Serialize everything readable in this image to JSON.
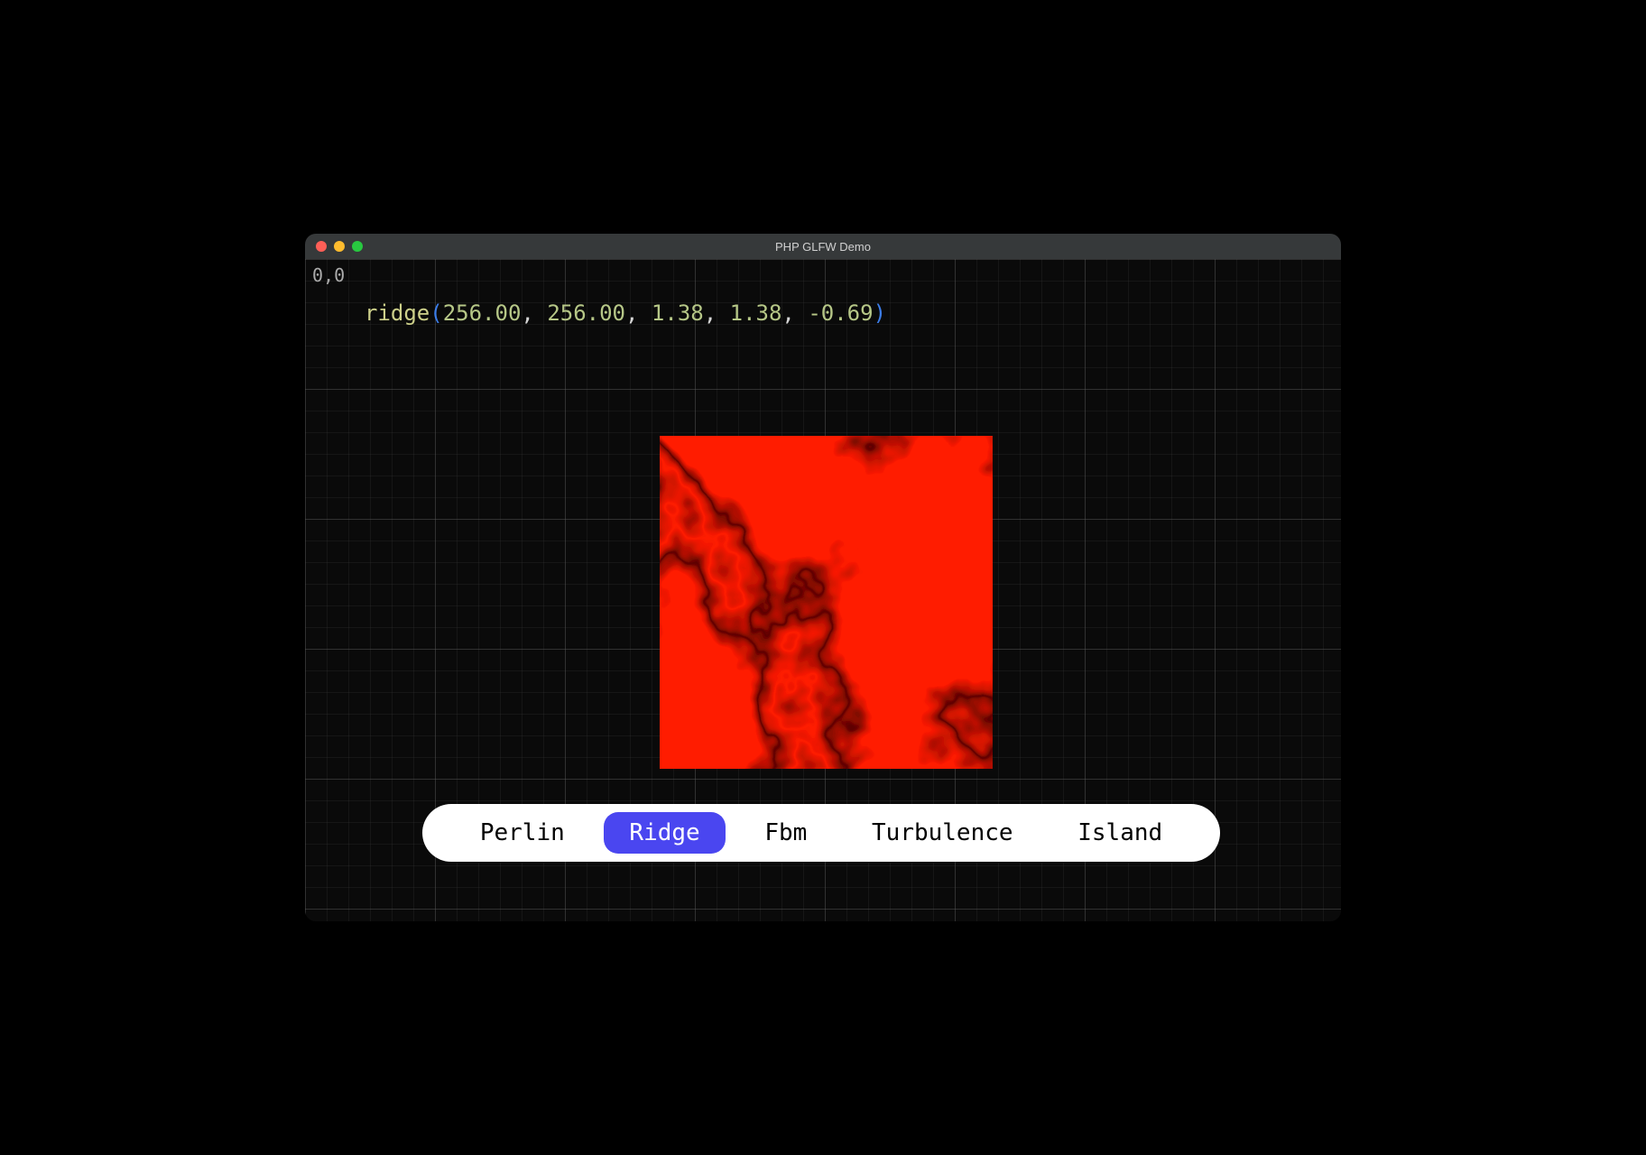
{
  "window": {
    "title": "PHP GLFW Demo"
  },
  "viewport": {
    "origin_label": "0,0"
  },
  "function_call": {
    "name": "ridge",
    "arg1": "256.00",
    "arg2": "256.00",
    "arg3": "1.38",
    "arg4": "1.38",
    "arg5": "-0.69"
  },
  "tabs": {
    "items": [
      "Perlin",
      "Ridge",
      "Fbm",
      "Turbulence",
      "Island"
    ],
    "active_index": 1
  },
  "colors": {
    "tab_active_bg": "#4a46f0",
    "noise_primary": "#ff0000"
  }
}
